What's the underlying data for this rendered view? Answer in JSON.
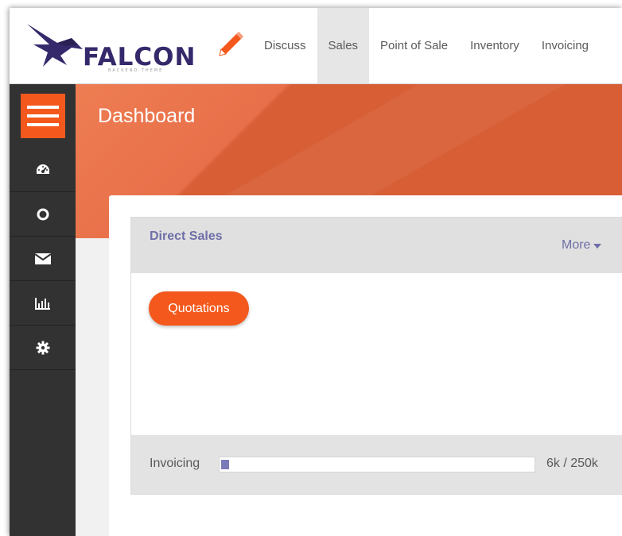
{
  "brand": {
    "name": "FALCON",
    "tagline": "BACKEND THEME"
  },
  "nav": {
    "items": [
      {
        "label": "Discuss",
        "active": false
      },
      {
        "label": "Sales",
        "active": true
      },
      {
        "label": "Point of Sale",
        "active": false
      },
      {
        "label": "Inventory",
        "active": false
      },
      {
        "label": "Invoicing",
        "active": false
      }
    ]
  },
  "sidebar": {
    "icons": [
      "menu-icon",
      "dashboard-icon",
      "circle-icon",
      "envelope-icon",
      "bar-chart-icon",
      "gear-icon"
    ]
  },
  "page": {
    "title": "Dashboard"
  },
  "card": {
    "title": "Direct Sales",
    "more_label": "More",
    "quotations_label": "Quotations",
    "footer_label": "Invoicing",
    "progress_value": 0.024,
    "progress_text": "6k / 250k"
  },
  "colors": {
    "accent": "#f4581c",
    "brand_purple": "#35296b",
    "link_purple": "#6f6fa8",
    "sidebar_bg": "#323232",
    "hero": "#d75e35"
  }
}
